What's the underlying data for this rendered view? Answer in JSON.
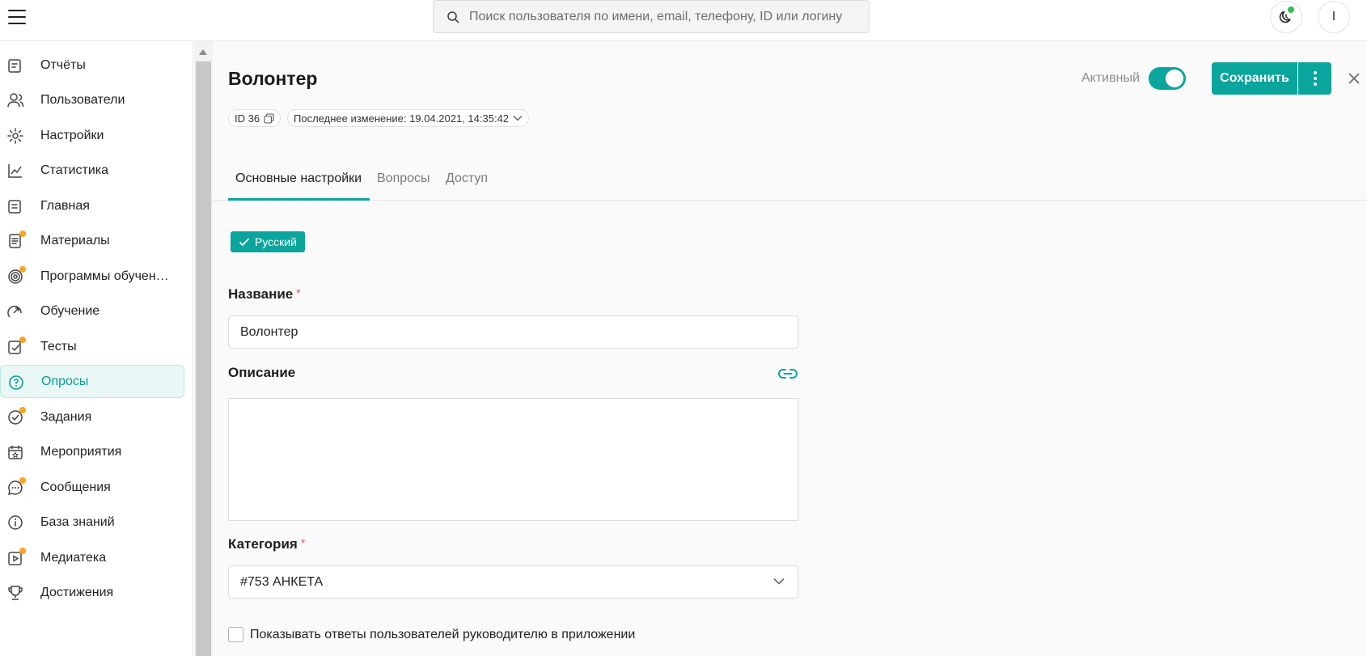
{
  "header": {
    "search_placeholder": "Поиск пользователя по имени, email, телефону, ID или логину",
    "avatar_initial": "I"
  },
  "sidebar": {
    "items": [
      {
        "label": "Отчёты",
        "icon": "report-icon",
        "badge": false
      },
      {
        "label": "Пользователи",
        "icon": "users-icon",
        "badge": false
      },
      {
        "label": "Настройки",
        "icon": "gear-icon",
        "badge": false
      },
      {
        "label": "Статистика",
        "icon": "chart-icon",
        "badge": false
      },
      {
        "label": "Главная",
        "icon": "home-icon",
        "badge": false
      },
      {
        "label": "Материалы",
        "icon": "document-icon",
        "badge": true
      },
      {
        "label": "Программы обучен…",
        "icon": "target-icon",
        "badge": true
      },
      {
        "label": "Обучение",
        "icon": "learning-icon",
        "badge": false
      },
      {
        "label": "Тесты",
        "icon": "test-icon",
        "badge": true
      },
      {
        "label": "Опросы",
        "icon": "survey-icon",
        "badge": false,
        "active": true
      },
      {
        "label": "Задания",
        "icon": "task-icon",
        "badge": true
      },
      {
        "label": "Мероприятия",
        "icon": "calendar-icon",
        "badge": false
      },
      {
        "label": "Сообщения",
        "icon": "message-icon",
        "badge": true
      },
      {
        "label": "База знаний",
        "icon": "info-icon",
        "badge": false
      },
      {
        "label": "Медиатека",
        "icon": "media-icon",
        "badge": true
      },
      {
        "label": "Достижения",
        "icon": "trophy-icon",
        "badge": false
      }
    ]
  },
  "page": {
    "title": "Волонтер",
    "status_label": "Активный",
    "status_active": true,
    "save_label": "Сохранить",
    "id_label": "ID 36",
    "last_modified": "Последнее изменение: 19.04.2021, 14:35:42"
  },
  "tabs": [
    {
      "label": "Основные настройки",
      "active": true
    },
    {
      "label": "Вопросы",
      "active": false
    },
    {
      "label": "Доступ",
      "active": false
    }
  ],
  "form": {
    "language_chip": "Русский",
    "name_label": "Название",
    "name_value": "Волонтер",
    "required_mark": "*",
    "description_label": "Описание",
    "description_value": "",
    "category_label": "Категория",
    "category_value": "#753 АНКЕТА",
    "checkbox_label": "Показывать ответы пользователей руководителю в приложении",
    "checkbox_checked": false
  },
  "colors": {
    "accent": "#0aa59c",
    "badge": "#f5a524",
    "online": "#2fc04f"
  }
}
